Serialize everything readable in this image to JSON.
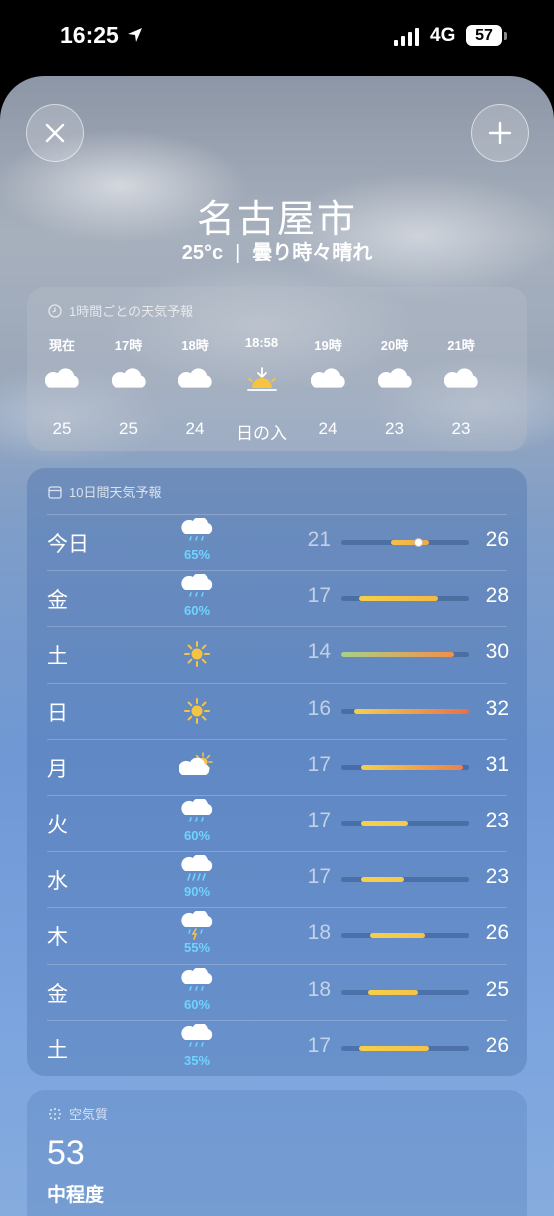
{
  "status": {
    "time": "16:25",
    "network": "4G",
    "battery": "57"
  },
  "location": {
    "city": "名古屋市",
    "temperature": "25°c",
    "condition": "曇り時々晴れ"
  },
  "hourly": {
    "title": "1時間ごとの天気予報",
    "items": [
      {
        "label": "現在",
        "icon": "cloud-icon",
        "value": "25"
      },
      {
        "label": "17時",
        "icon": "cloud-icon",
        "value": "25"
      },
      {
        "label": "18時",
        "icon": "cloud-icon",
        "value": "24"
      },
      {
        "label": "18:58",
        "icon": "sunset-icon",
        "value": "日の入"
      },
      {
        "label": "19時",
        "icon": "cloud-icon",
        "value": "24"
      },
      {
        "label": "20時",
        "icon": "cloud-icon",
        "value": "23"
      },
      {
        "label": "21時",
        "icon": "cloud-icon",
        "value": "23"
      }
    ]
  },
  "daily": {
    "title": "10日間天気予報",
    "days": [
      {
        "day": "今日",
        "icon": "rain-cloud-icon",
        "precip": "65%",
        "low": "21",
        "high": "26",
        "bar_start": 0.39,
        "bar_end": 0.69,
        "current": 0.6,
        "color_from": "#f6c04a",
        "color_to": "#f0a848"
      },
      {
        "day": "金",
        "icon": "rain-cloud-icon",
        "precip": "60%",
        "low": "17",
        "high": "28",
        "bar_start": 0.14,
        "bar_end": 0.76,
        "current": null,
        "color_from": "#f5d04a",
        "color_to": "#f4b845"
      },
      {
        "day": "土",
        "icon": "sun-icon",
        "precip": "",
        "low": "14",
        "high": "30",
        "bar_start": 0.0,
        "bar_end": 0.88,
        "current": null,
        "color_from": "#a8d08a",
        "color_to": "#f0904a"
      },
      {
        "day": "日",
        "icon": "sun-icon",
        "precip": "",
        "low": "16",
        "high": "32",
        "bar_start": 0.1,
        "bar_end": 1.0,
        "current": null,
        "color_from": "#f5d04a",
        "color_to": "#e8704a"
      },
      {
        "day": "月",
        "icon": "partly-sunny-icon",
        "precip": "",
        "low": "17",
        "high": "31",
        "bar_start": 0.16,
        "bar_end": 0.95,
        "current": null,
        "color_from": "#f5d04a",
        "color_to": "#ec7f4a"
      },
      {
        "day": "火",
        "icon": "rain-cloud-icon",
        "precip": "60%",
        "low": "17",
        "high": "23",
        "bar_start": 0.16,
        "bar_end": 0.52,
        "current": null,
        "color_from": "#f5d04a",
        "color_to": "#f5c94a"
      },
      {
        "day": "水",
        "icon": "heavy-rain-cloud-icon",
        "precip": "90%",
        "low": "17",
        "high": "23",
        "bar_start": 0.16,
        "bar_end": 0.49,
        "current": null,
        "color_from": "#f5d04a",
        "color_to": "#f5c94a"
      },
      {
        "day": "木",
        "icon": "thunderstorm-cloud-icon",
        "precip": "55%",
        "low": "18",
        "high": "26",
        "bar_start": 0.23,
        "bar_end": 0.66,
        "current": null,
        "color_from": "#f5d04a",
        "color_to": "#f5c24a"
      },
      {
        "day": "金",
        "icon": "rain-cloud-icon",
        "precip": "60%",
        "low": "18",
        "high": "25",
        "bar_start": 0.21,
        "bar_end": 0.6,
        "current": null,
        "color_from": "#f5d04a",
        "color_to": "#f5c24a"
      },
      {
        "day": "土",
        "icon": "rain-cloud-icon",
        "precip": "35%",
        "low": "17",
        "high": "26",
        "bar_start": 0.14,
        "bar_end": 0.69,
        "current": null,
        "color_from": "#f5d04a",
        "color_to": "#f5c24a"
      }
    ]
  },
  "air_quality": {
    "title": "空気質",
    "value": "53",
    "level": "中程度"
  }
}
